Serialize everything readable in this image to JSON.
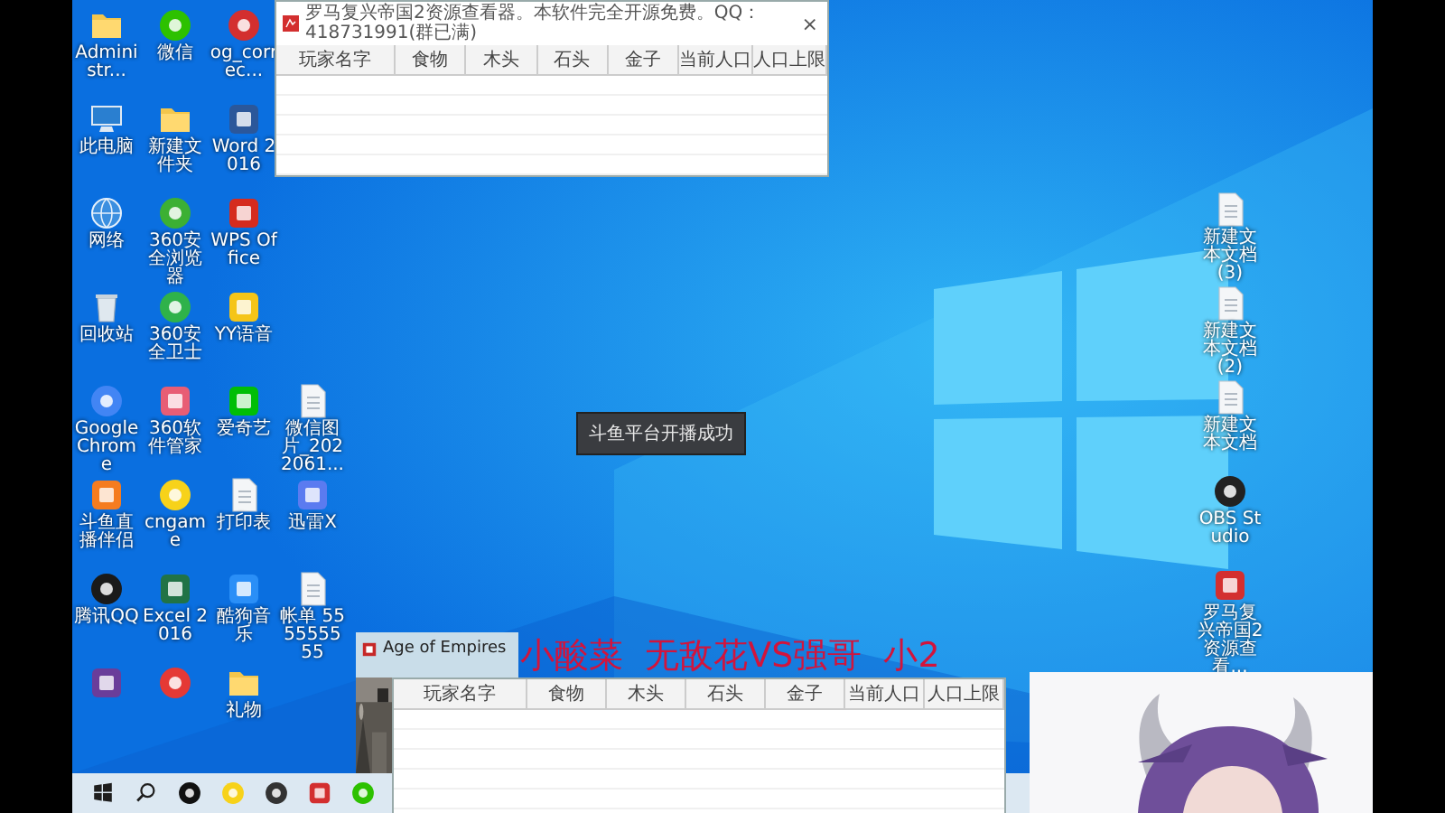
{
  "desktop": {
    "left_columns": [
      [
        {
          "label": "Administr...",
          "kind": "folder"
        },
        {
          "label": "此电脑",
          "kind": "computer"
        },
        {
          "label": "网络",
          "kind": "globe"
        },
        {
          "label": "回收站",
          "kind": "recycle"
        },
        {
          "label": "Google Chrome",
          "kind": "round",
          "color": "#4285f4"
        },
        {
          "label": "斗鱼直播伴侣",
          "kind": "app",
          "color": "#f57c1f"
        },
        {
          "label": "腾讯QQ",
          "kind": "round",
          "color": "#1a1a1a"
        },
        {
          "kind": "app",
          "color": "#6a3d9a"
        }
      ],
      [
        {
          "label": "微信",
          "kind": "round",
          "color": "#2dc100"
        },
        {
          "label": "新建文件夹",
          "kind": "folder"
        },
        {
          "label": "360安全浏览器",
          "kind": "round",
          "color": "#3cb034"
        },
        {
          "label": "360安全卫士",
          "kind": "round",
          "color": "#2fb24a"
        },
        {
          "label": "360软件管家",
          "kind": "app",
          "color": "#e85d75"
        },
        {
          "label": "cngame",
          "kind": "round",
          "color": "#f7d21a"
        },
        {
          "label": "Excel 2016",
          "kind": "app",
          "color": "#217346"
        },
        {
          "kind": "round",
          "color": "#e53935"
        }
      ],
      [
        {
          "label": "og_correc...",
          "kind": "round",
          "color": "#d32f2f"
        },
        {
          "label": "Word 2016",
          "kind": "app",
          "color": "#2b579a"
        },
        {
          "label": "WPS Office",
          "kind": "app",
          "color": "#d52b1e"
        },
        {
          "label": "YY语音",
          "kind": "app",
          "color": "#f5c518"
        },
        {
          "label": "爱奇艺",
          "kind": "app",
          "color": "#00be06"
        },
        {
          "label": "打印表",
          "kind": "file"
        },
        {
          "label": "酷狗音乐",
          "kind": "app",
          "color": "#2a8ff7"
        },
        {
          "label": "礼物",
          "kind": "folder"
        }
      ],
      [
        {
          "label": "微信图片_2022061...",
          "kind": "file"
        },
        {
          "label": "迅雷X",
          "kind": "app",
          "color": "#5b7bf0"
        },
        {
          "label": "帐单 555555555",
          "kind": "file"
        }
      ]
    ],
    "right_icons": [
      {
        "label": "新建文本文档 (3)",
        "kind": "file"
      },
      {
        "label": "新建文本文档 (2)",
        "kind": "file"
      },
      {
        "label": "新建文本文档",
        "kind": "file"
      },
      {
        "label": "OBS Studio",
        "kind": "round",
        "color": "#222222"
      },
      {
        "label": "罗马复兴帝国2资源查看...",
        "kind": "app",
        "color": "#d32f2f"
      }
    ]
  },
  "windows": [
    {
      "title": "罗马复兴帝国2资源查看器。本软件完全开源免费。QQ：418731991(群已满)",
      "close": "×",
      "columns": [
        "玩家名字",
        "食物",
        "木头",
        "石头",
        "金子",
        "当前人口",
        "人口上限"
      ]
    },
    {
      "columns": [
        "玩家名字",
        "食物",
        "木头",
        "石头",
        "金子",
        "当前人口",
        "人口上限"
      ]
    }
  ],
  "toast": "斗鱼平台开播成功",
  "overlay_text": "小酸菜  无敌花VS强哥  小2",
  "thumbnail": {
    "title": "Age of Empires"
  },
  "taskbar": {
    "apps": [
      {
        "kind": "start"
      },
      {
        "kind": "search"
      },
      {
        "kind": "round",
        "color": "#111111"
      },
      {
        "kind": "round",
        "color": "#f7d21a"
      },
      {
        "kind": "round",
        "color": "#333333"
      },
      {
        "kind": "app",
        "color": "#d32f2f"
      },
      {
        "kind": "round",
        "color": "#2dc100"
      }
    ]
  }
}
